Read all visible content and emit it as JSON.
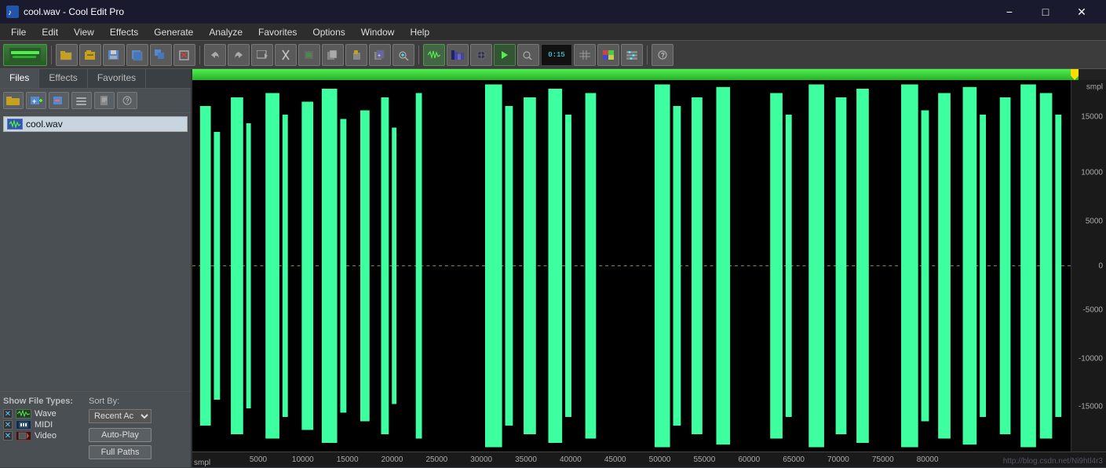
{
  "titlebar": {
    "title": "cool.wav - Cool Edit Pro",
    "icon": "audio-icon",
    "minimize_label": "−",
    "maximize_label": "□",
    "close_label": "✕"
  },
  "menubar": {
    "items": [
      "File",
      "Edit",
      "View",
      "Effects",
      "Generate",
      "Analyze",
      "Favorites",
      "Options",
      "Window",
      "Help"
    ]
  },
  "left_panel": {
    "tabs": [
      "Files",
      "Effects",
      "Favorites"
    ],
    "active_tab": "Files",
    "file_toolbar": [
      "open-folder",
      "open-file",
      "save",
      "options",
      "close",
      "help"
    ],
    "files": [
      {
        "name": "cool.wav",
        "icon": "wav-icon"
      }
    ],
    "show_file_types_label": "Show File Types:",
    "sort_by_label": "Sort By:",
    "sort_value": "Recent Ac▼",
    "types": [
      {
        "checked": true,
        "icon": "wave-mini-icon",
        "label": "Wave"
      },
      {
        "checked": true,
        "icon": "midi-mini-icon",
        "label": "MIDI"
      },
      {
        "checked": true,
        "icon": "video-mini-icon",
        "label": "Video"
      }
    ],
    "auto_play_label": "Auto-Play",
    "full_paths_label": "Full Paths"
  },
  "wave_view": {
    "progress_width_pct": 97,
    "y_labels": [
      "smpl",
      "15000",
      "10000",
      "5000",
      "0",
      "-5000",
      "-10000",
      "-15000"
    ],
    "y_positions_pct": [
      2,
      12,
      25,
      38,
      50,
      62,
      75,
      88
    ],
    "time_labels": [
      "smpl",
      "5000",
      "10000",
      "15000",
      "20000",
      "25000",
      "30000",
      "35000",
      "40000",
      "45000",
      "50000",
      "55000",
      "60000",
      "65000",
      "70000",
      "75000",
      "80000"
    ],
    "watermark": "http://blog.csdn.net/Ni9htl4r3"
  }
}
